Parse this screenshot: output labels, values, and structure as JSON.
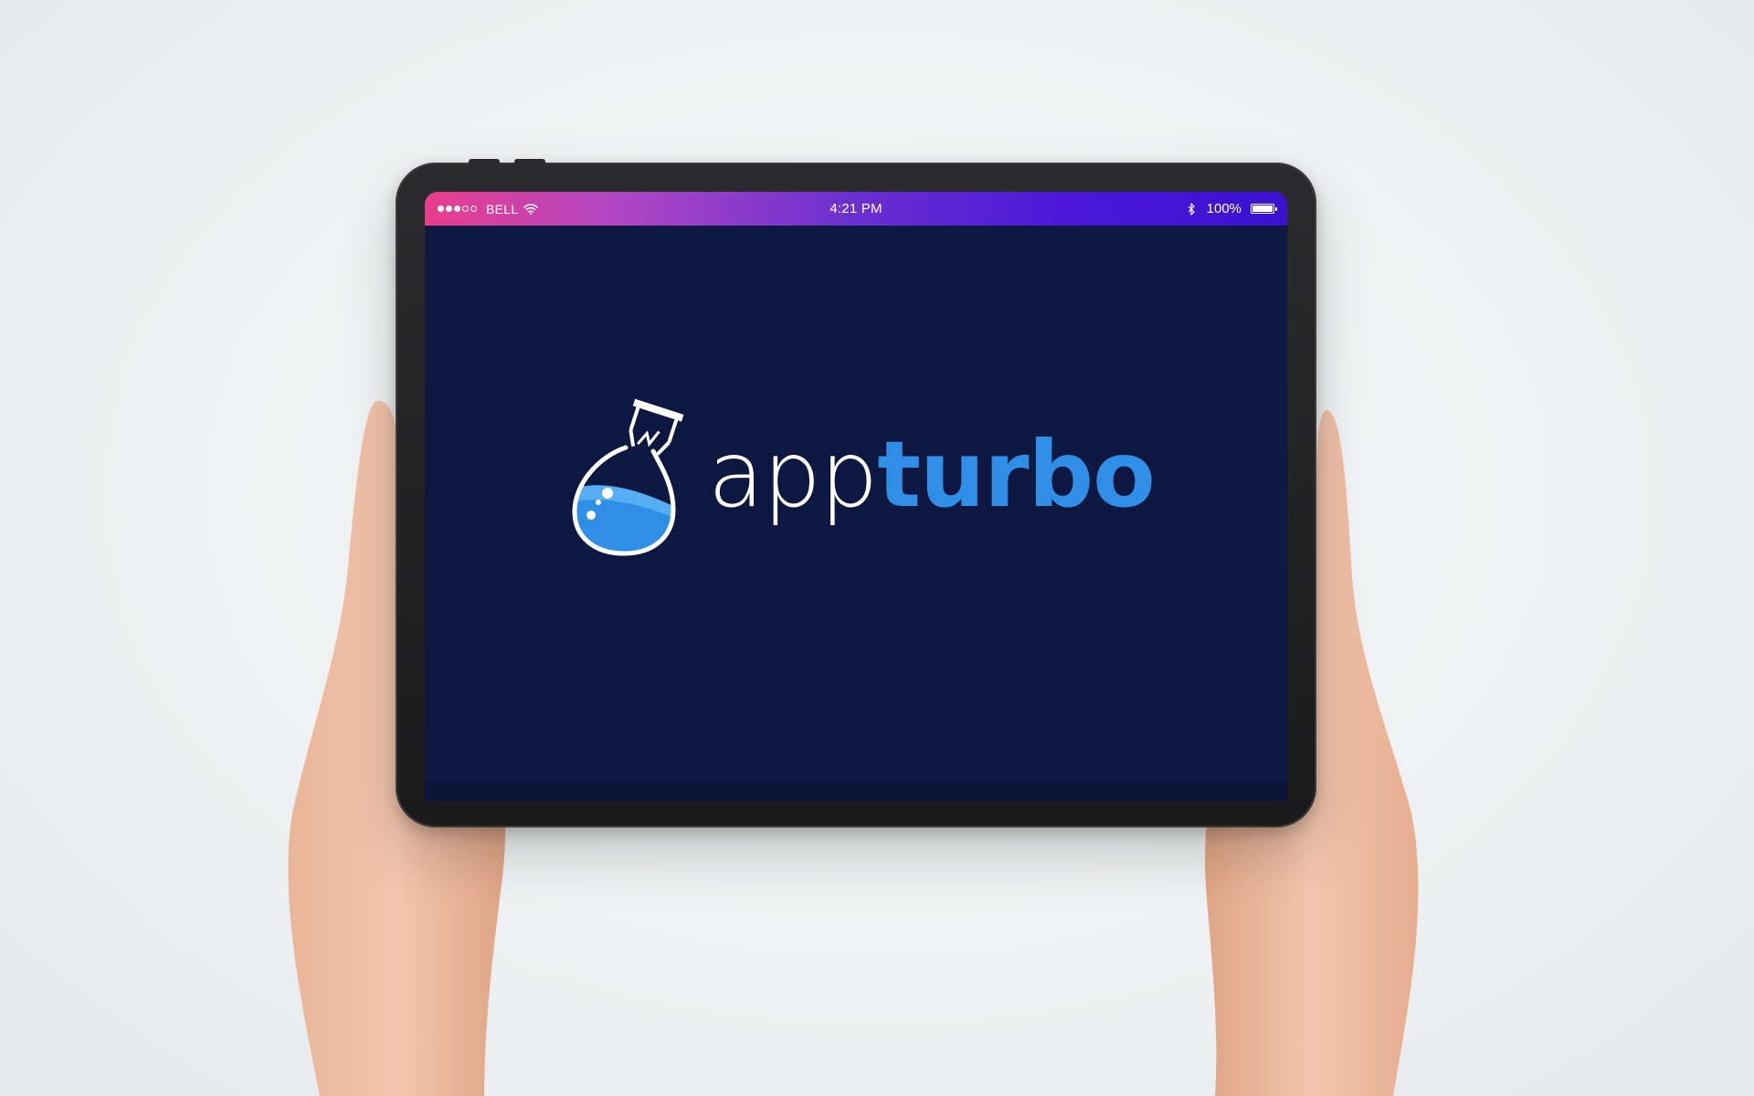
{
  "status_bar": {
    "carrier": "BELL",
    "time": "4:21 PM",
    "battery_percent": "100%",
    "signal_bars_filled": 3,
    "signal_bars_total": 5,
    "icons": [
      "signal-dots-icon",
      "wifi-icon",
      "bluetooth-icon",
      "battery-icon"
    ]
  },
  "app": {
    "logo_word_1": "app",
    "logo_word_2": "turbo",
    "logo_icon": "flask-lightbulb-icon"
  },
  "colors": {
    "screen_background": "#0e1740",
    "brand_blue": "#2f8fe6",
    "status_gradient_start": "#e83e8c",
    "status_gradient_end": "#3b12cf",
    "logo_text_light": "#ffffff"
  }
}
